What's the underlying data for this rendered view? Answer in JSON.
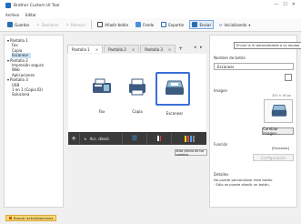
{
  "window": {
    "title": "Brother Custom UI Tool"
  },
  "menu": [
    "Archivo",
    "Editar"
  ],
  "toolbar": {
    "save": "Guardar",
    "undo": "Deshacer",
    "redo": "Rehacer",
    "add_button": "Añadir botón",
    "fondo": "Fondo",
    "exportar": "Exportar",
    "enviar": "Enviar",
    "inicializando": "Inicializando"
  },
  "tooltip": "Enviar la IU personalizada a un equipo.",
  "tree": [
    {
      "label": "Pantalla 1",
      "level": 0,
      "prefix": "▾"
    },
    {
      "label": "Fax",
      "level": 1
    },
    {
      "label": "Copia",
      "level": 1
    },
    {
      "label": "Escanear",
      "level": 1,
      "selected": true
    },
    {
      "label": "Pantalla 2",
      "level": 0,
      "prefix": "▾"
    },
    {
      "label": "Impresión segura",
      "level": 1
    },
    {
      "label": "Web",
      "level": 1
    },
    {
      "label": "Aplicaciones",
      "level": 1
    },
    {
      "label": "Pantalla 3",
      "level": 0,
      "prefix": "▾"
    },
    {
      "label": "USB",
      "level": 1
    },
    {
      "label": "1 en 1 (Copia ID)",
      "level": 1
    },
    {
      "label": "Soluciona",
      "level": 1
    }
  ],
  "tabs": [
    "Pantalla 1",
    "Pantalla 2",
    "Pantalla 3"
  ],
  "screen": {
    "tiles": [
      {
        "label": "Fax"
      },
      {
        "label": "Copia"
      },
      {
        "label": "Escanear"
      }
    ],
    "shortcut_label": "Acc. direct."
  },
  "web_preview_button": "Vista previa de los cambios",
  "properties": {
    "button_name_label": "Nombre de botón",
    "button_name_value": "Escanear",
    "image_label": "Imagen",
    "image_size": "320 × 90 px",
    "change_image_button": "Cambiar imagen...",
    "function_label": "Función",
    "function_value": "[Escanear]",
    "config_button": "Configuración",
    "details_label": "Detalles",
    "details_text": "No puede personalizar este botón.\n· Sólo se puede añadir un botón."
  },
  "status": {
    "update_button": "Buscar actualizaciones"
  },
  "colors": {
    "accent": "#1f6fc1",
    "screen_bg": "#2f2f2f",
    "selected": "#3a6fd8"
  }
}
